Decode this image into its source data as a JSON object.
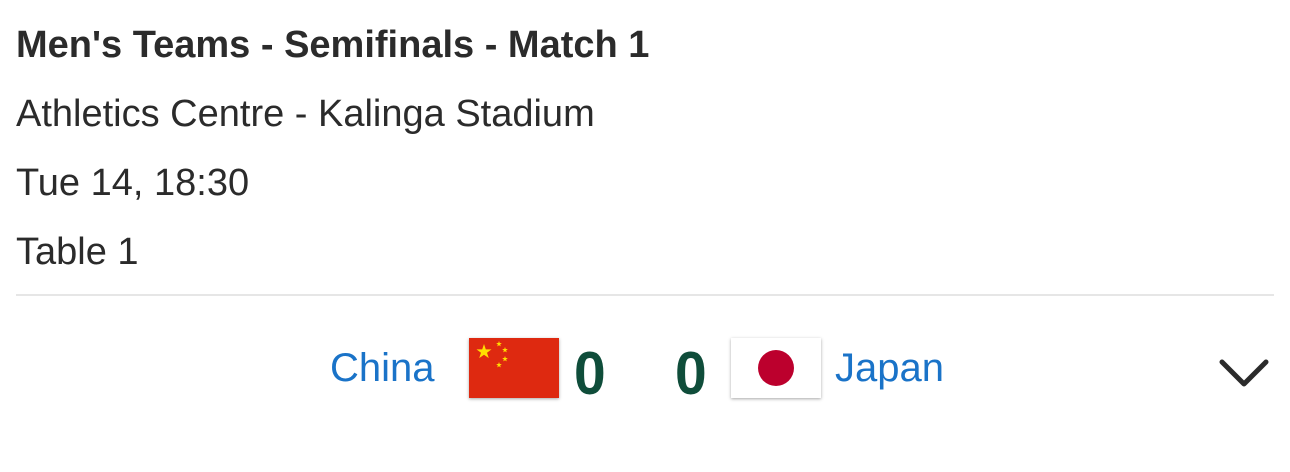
{
  "match": {
    "title": "Men's Teams - Semifinals - Match 1",
    "venue": "Athletics Centre - Kalinga Stadium",
    "datetime": "Tue 14, 18:30",
    "table": "Table 1"
  },
  "home": {
    "name": "China",
    "score": "0",
    "flag_icon": "china-flag-icon",
    "flag_color": "#de2910",
    "star_color": "#ffde00"
  },
  "away": {
    "name": "Japan",
    "score": "0",
    "flag_icon": "japan-flag-icon",
    "flag_color": "#ffffff",
    "disc_color": "#bc002d"
  },
  "colors": {
    "team_link": "#1a73c8",
    "score": "#0f4d3a",
    "divider": "#e6e6e6"
  },
  "expand_icon": "chevron-down-icon"
}
